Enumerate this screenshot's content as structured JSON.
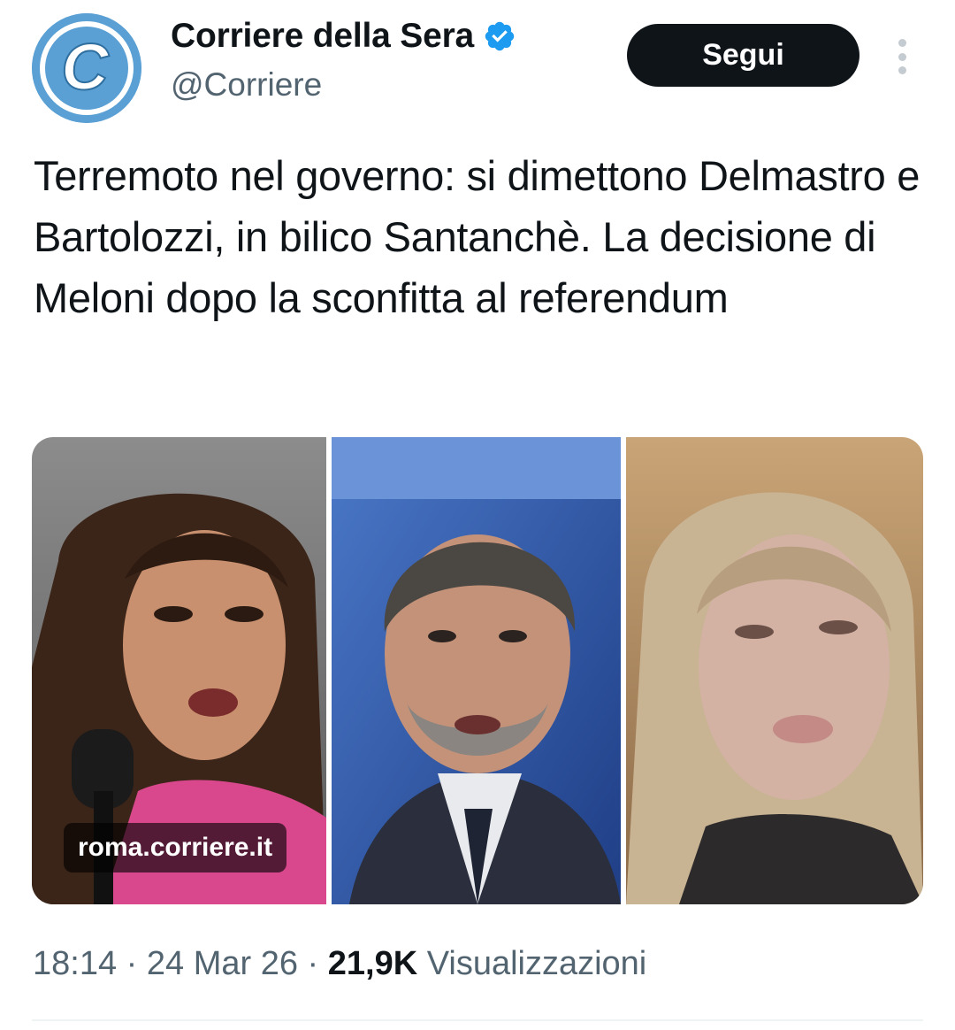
{
  "author": {
    "display_name": "Corriere della Sera",
    "handle": "@Corriere",
    "verified": true,
    "avatar_letter": "C"
  },
  "actions": {
    "follow_label": "Segui"
  },
  "tweet": {
    "text": "Terremoto nel governo: si dimettono Delmastro e Bartolozzi, in bilico Santanchè. La decisione di Meloni dopo la sconfitta al referendum",
    "link_domain": "roma.corriere.it"
  },
  "meta": {
    "time": "18:14",
    "separator": " · ",
    "date": "24 Mar 26",
    "views_count": "21,9K",
    "views_label": " Visualizzazioni"
  },
  "colors": {
    "avatar_blue": "#5aa0d4",
    "verified_blue": "#1d9bf0",
    "text_primary": "#0f1419",
    "text_secondary": "#536471"
  },
  "icons": {
    "verified": "verified-badge-icon",
    "more": "more-options-icon"
  }
}
